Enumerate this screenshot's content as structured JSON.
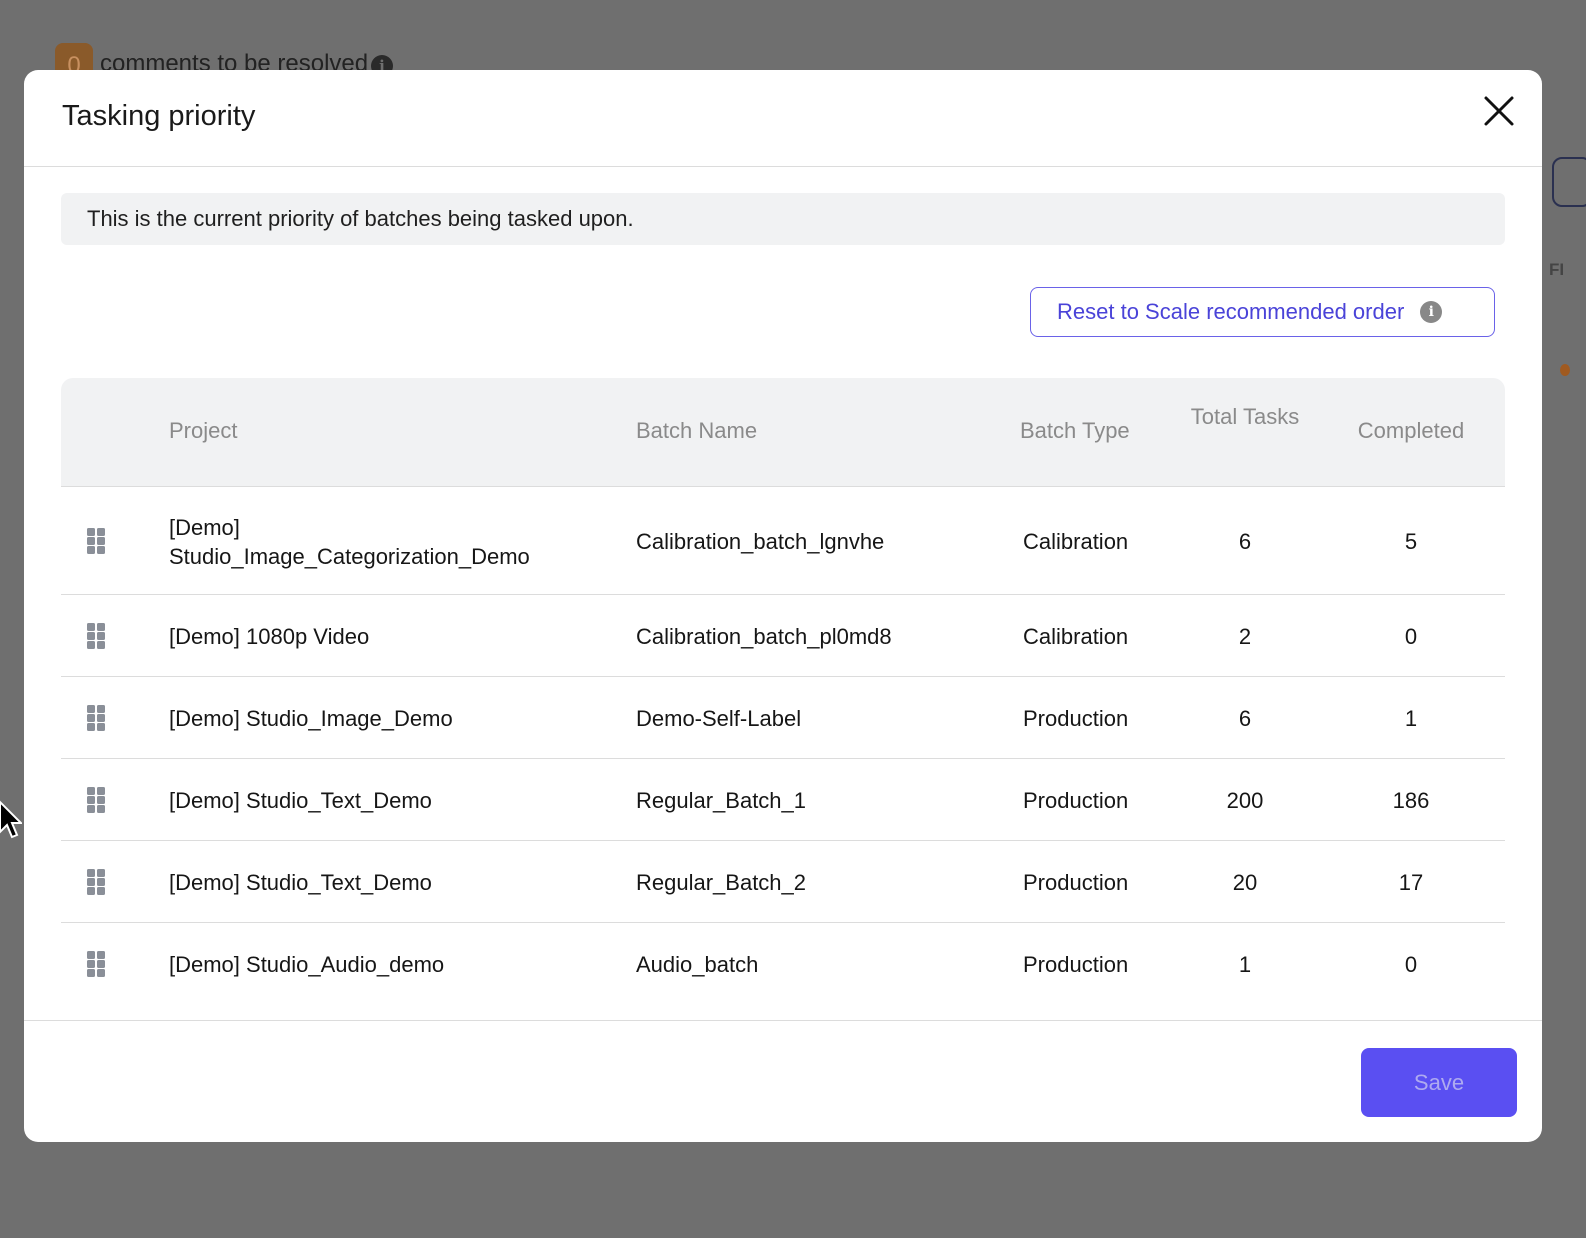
{
  "background": {
    "badge_count": "0",
    "comments_text": "comments to be resolved",
    "right_partial_text": "FI"
  },
  "modal": {
    "title": "Tasking priority",
    "info_text": "This is the current priority of batches being tasked upon.",
    "reset_button_label": "Reset to Scale recommended order",
    "save_button_label": "Save"
  },
  "table": {
    "headers": {
      "project": "Project",
      "batch_name": "Batch Name",
      "batch_type": "Batch Type",
      "total_tasks": "Total Tasks",
      "completed": "Completed"
    },
    "rows": [
      {
        "project": "[Demo] Studio_Image_Categorization_Demo",
        "batch_name": "Calibration_batch_lgnvhe",
        "batch_type": "Calibration",
        "total_tasks": "6",
        "completed": "5"
      },
      {
        "project": "[Demo] 1080p Video",
        "batch_name": "Calibration_batch_pl0md8",
        "batch_type": "Calibration",
        "total_tasks": "2",
        "completed": "0"
      },
      {
        "project": "[Demo] Studio_Image_Demo",
        "batch_name": "Demo-Self-Label",
        "batch_type": "Production",
        "total_tasks": "6",
        "completed": "1"
      },
      {
        "project": "[Demo] Studio_Text_Demo",
        "batch_name": "Regular_Batch_1",
        "batch_type": "Production",
        "total_tasks": "200",
        "completed": "186"
      },
      {
        "project": "[Demo] Studio_Text_Demo",
        "batch_name": "Regular_Batch_2",
        "batch_type": "Production",
        "total_tasks": "20",
        "completed": "17"
      },
      {
        "project": "[Demo] Studio_Audio_demo",
        "batch_name": "Audio_batch",
        "batch_type": "Production",
        "total_tasks": "1",
        "completed": "0"
      }
    ]
  },
  "colors": {
    "accent": "#5a4ff2",
    "link": "#4a43d8",
    "overlay": "#6f6f6f"
  },
  "icons": {
    "close": "close-icon",
    "drag": "drag-handle-icon",
    "info": "info-icon"
  }
}
